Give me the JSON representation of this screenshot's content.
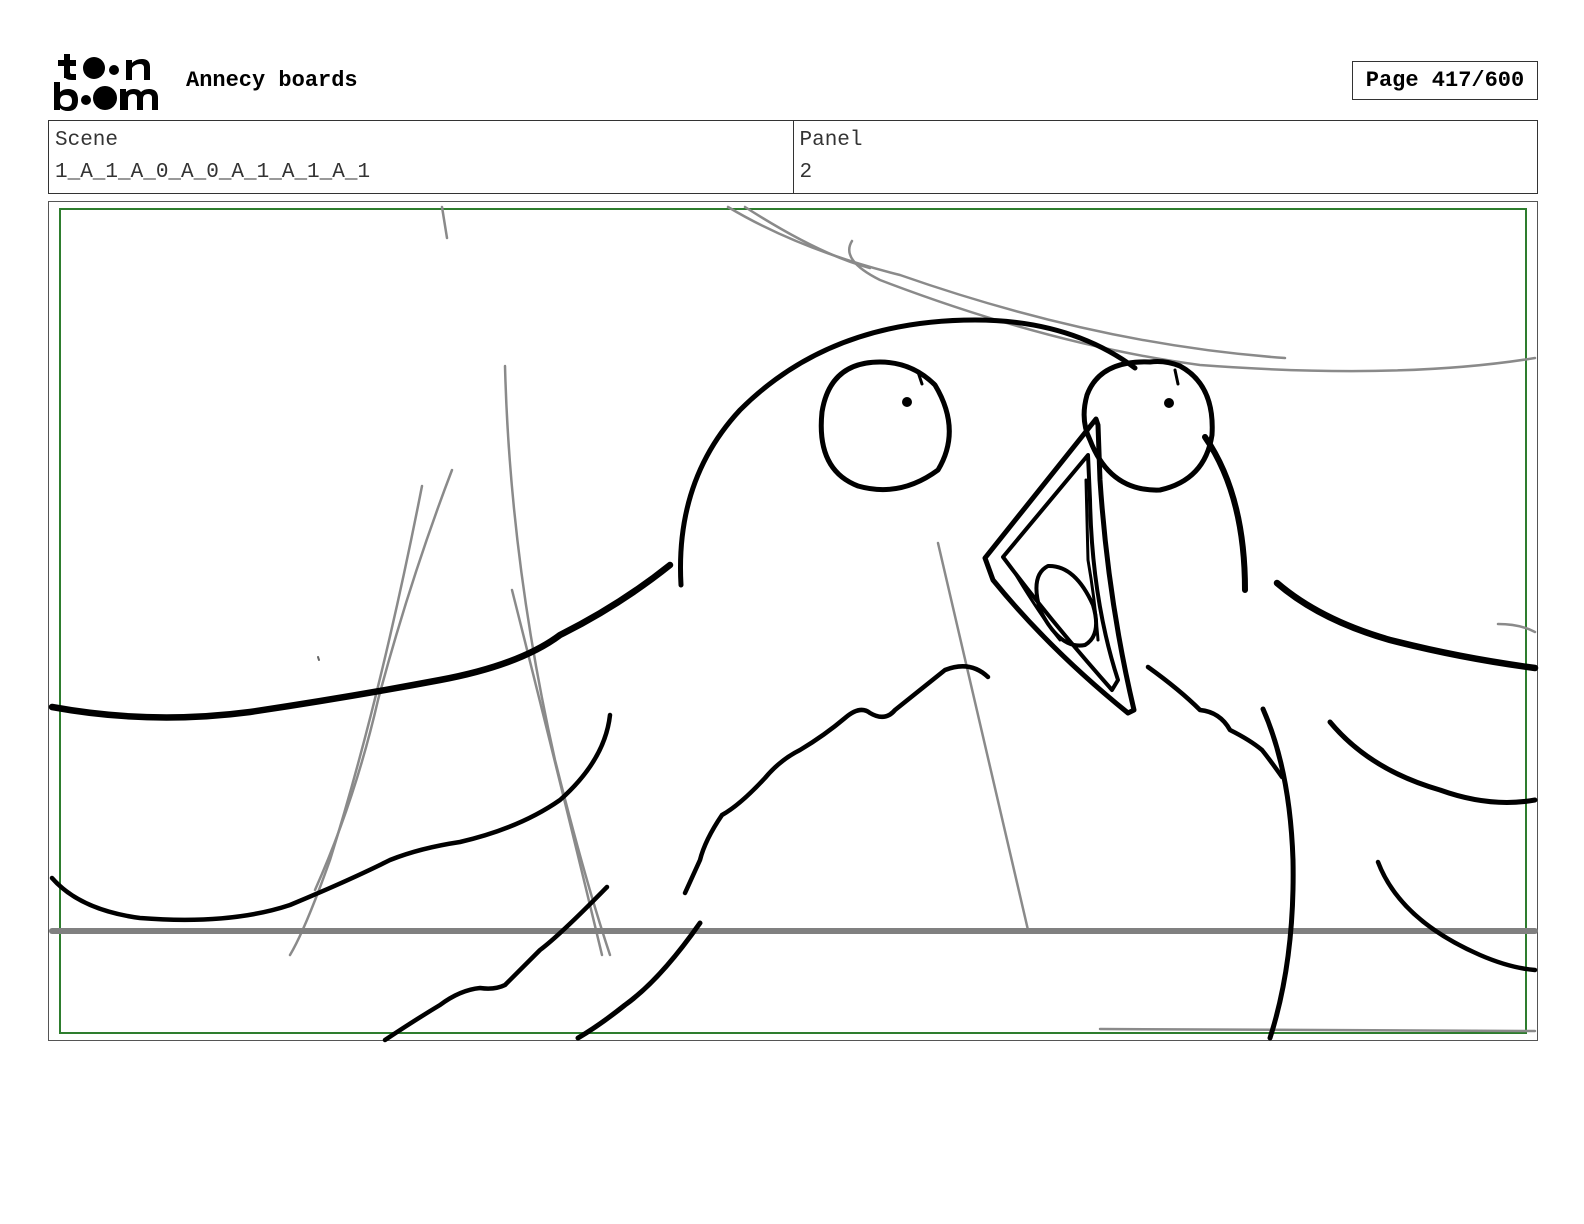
{
  "logo": {
    "line1": "toon",
    "line2": "boom"
  },
  "header": {
    "title": "Annecy boards",
    "page": "Page 417/600"
  },
  "info": {
    "scene_label": "Scene",
    "scene_value": "1_A_1_A_0_A_0_A_1_A_1_A_1",
    "panel_label": "Panel",
    "panel_value": "2"
  }
}
